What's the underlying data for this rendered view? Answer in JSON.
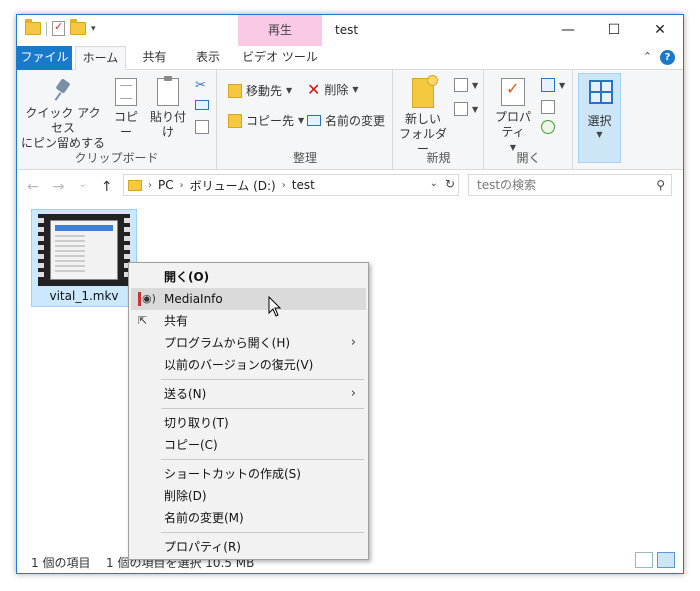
{
  "window": {
    "title": "test",
    "context_tab_header": "再生",
    "caption": {
      "minimize": "—",
      "maximize": "☐",
      "close": "✕"
    }
  },
  "ribbon_tabs": {
    "file": "ファイル",
    "home": "ホーム",
    "share": "共有",
    "view": "表示",
    "video_tools": "ビデオ ツール",
    "collapse": "⌃",
    "help": "?"
  },
  "ribbon": {
    "clipboard": {
      "label": "クリップボード",
      "pin_line1": "クイック アクセス",
      "pin_line2": "にピン留めする",
      "copy": "コピー",
      "paste": "貼り付け"
    },
    "organize": {
      "label": "整理",
      "move_to": "移動先",
      "copy_to": "コピー先",
      "delete": "削除",
      "rename": "名前の変更"
    },
    "new": {
      "label": "新規",
      "new_folder_line1": "新しい",
      "new_folder_line2": "フォルダー"
    },
    "open": {
      "label": "開く",
      "properties": "プロパティ"
    },
    "select": {
      "label": "選択"
    }
  },
  "navigation": {
    "back": "←",
    "forward": "→",
    "recent": "⌄",
    "up": "↑",
    "breadcrumb": [
      "PC",
      "ボリューム (D:)",
      "test"
    ],
    "search_placeholder": "testの検索"
  },
  "files": [
    {
      "name": "vital_1.mkv"
    }
  ],
  "status": {
    "item_count": "1 個の項目",
    "selection": "1 個の項目を選択  10.5 MB"
  },
  "context_menu": {
    "items": [
      {
        "label": "開く(O)"
      },
      {
        "label": "MediaInfo"
      },
      {
        "label": "共有"
      },
      {
        "label": "プログラムから開く(H)"
      },
      {
        "label": "以前のバージョンの復元(V)"
      },
      {
        "label": "送る(N)"
      },
      {
        "label": "切り取り(T)"
      },
      {
        "label": "コピー(C)"
      },
      {
        "label": "ショートカットの作成(S)"
      },
      {
        "label": "削除(D)"
      },
      {
        "label": "名前の変更(M)"
      },
      {
        "label": "プロパティ(R)"
      }
    ]
  },
  "colors": {
    "accent": "#1979ca",
    "context_tab": "#f9c9e6",
    "selection": "#cce8ff",
    "menu_highlight": "#dadada"
  }
}
